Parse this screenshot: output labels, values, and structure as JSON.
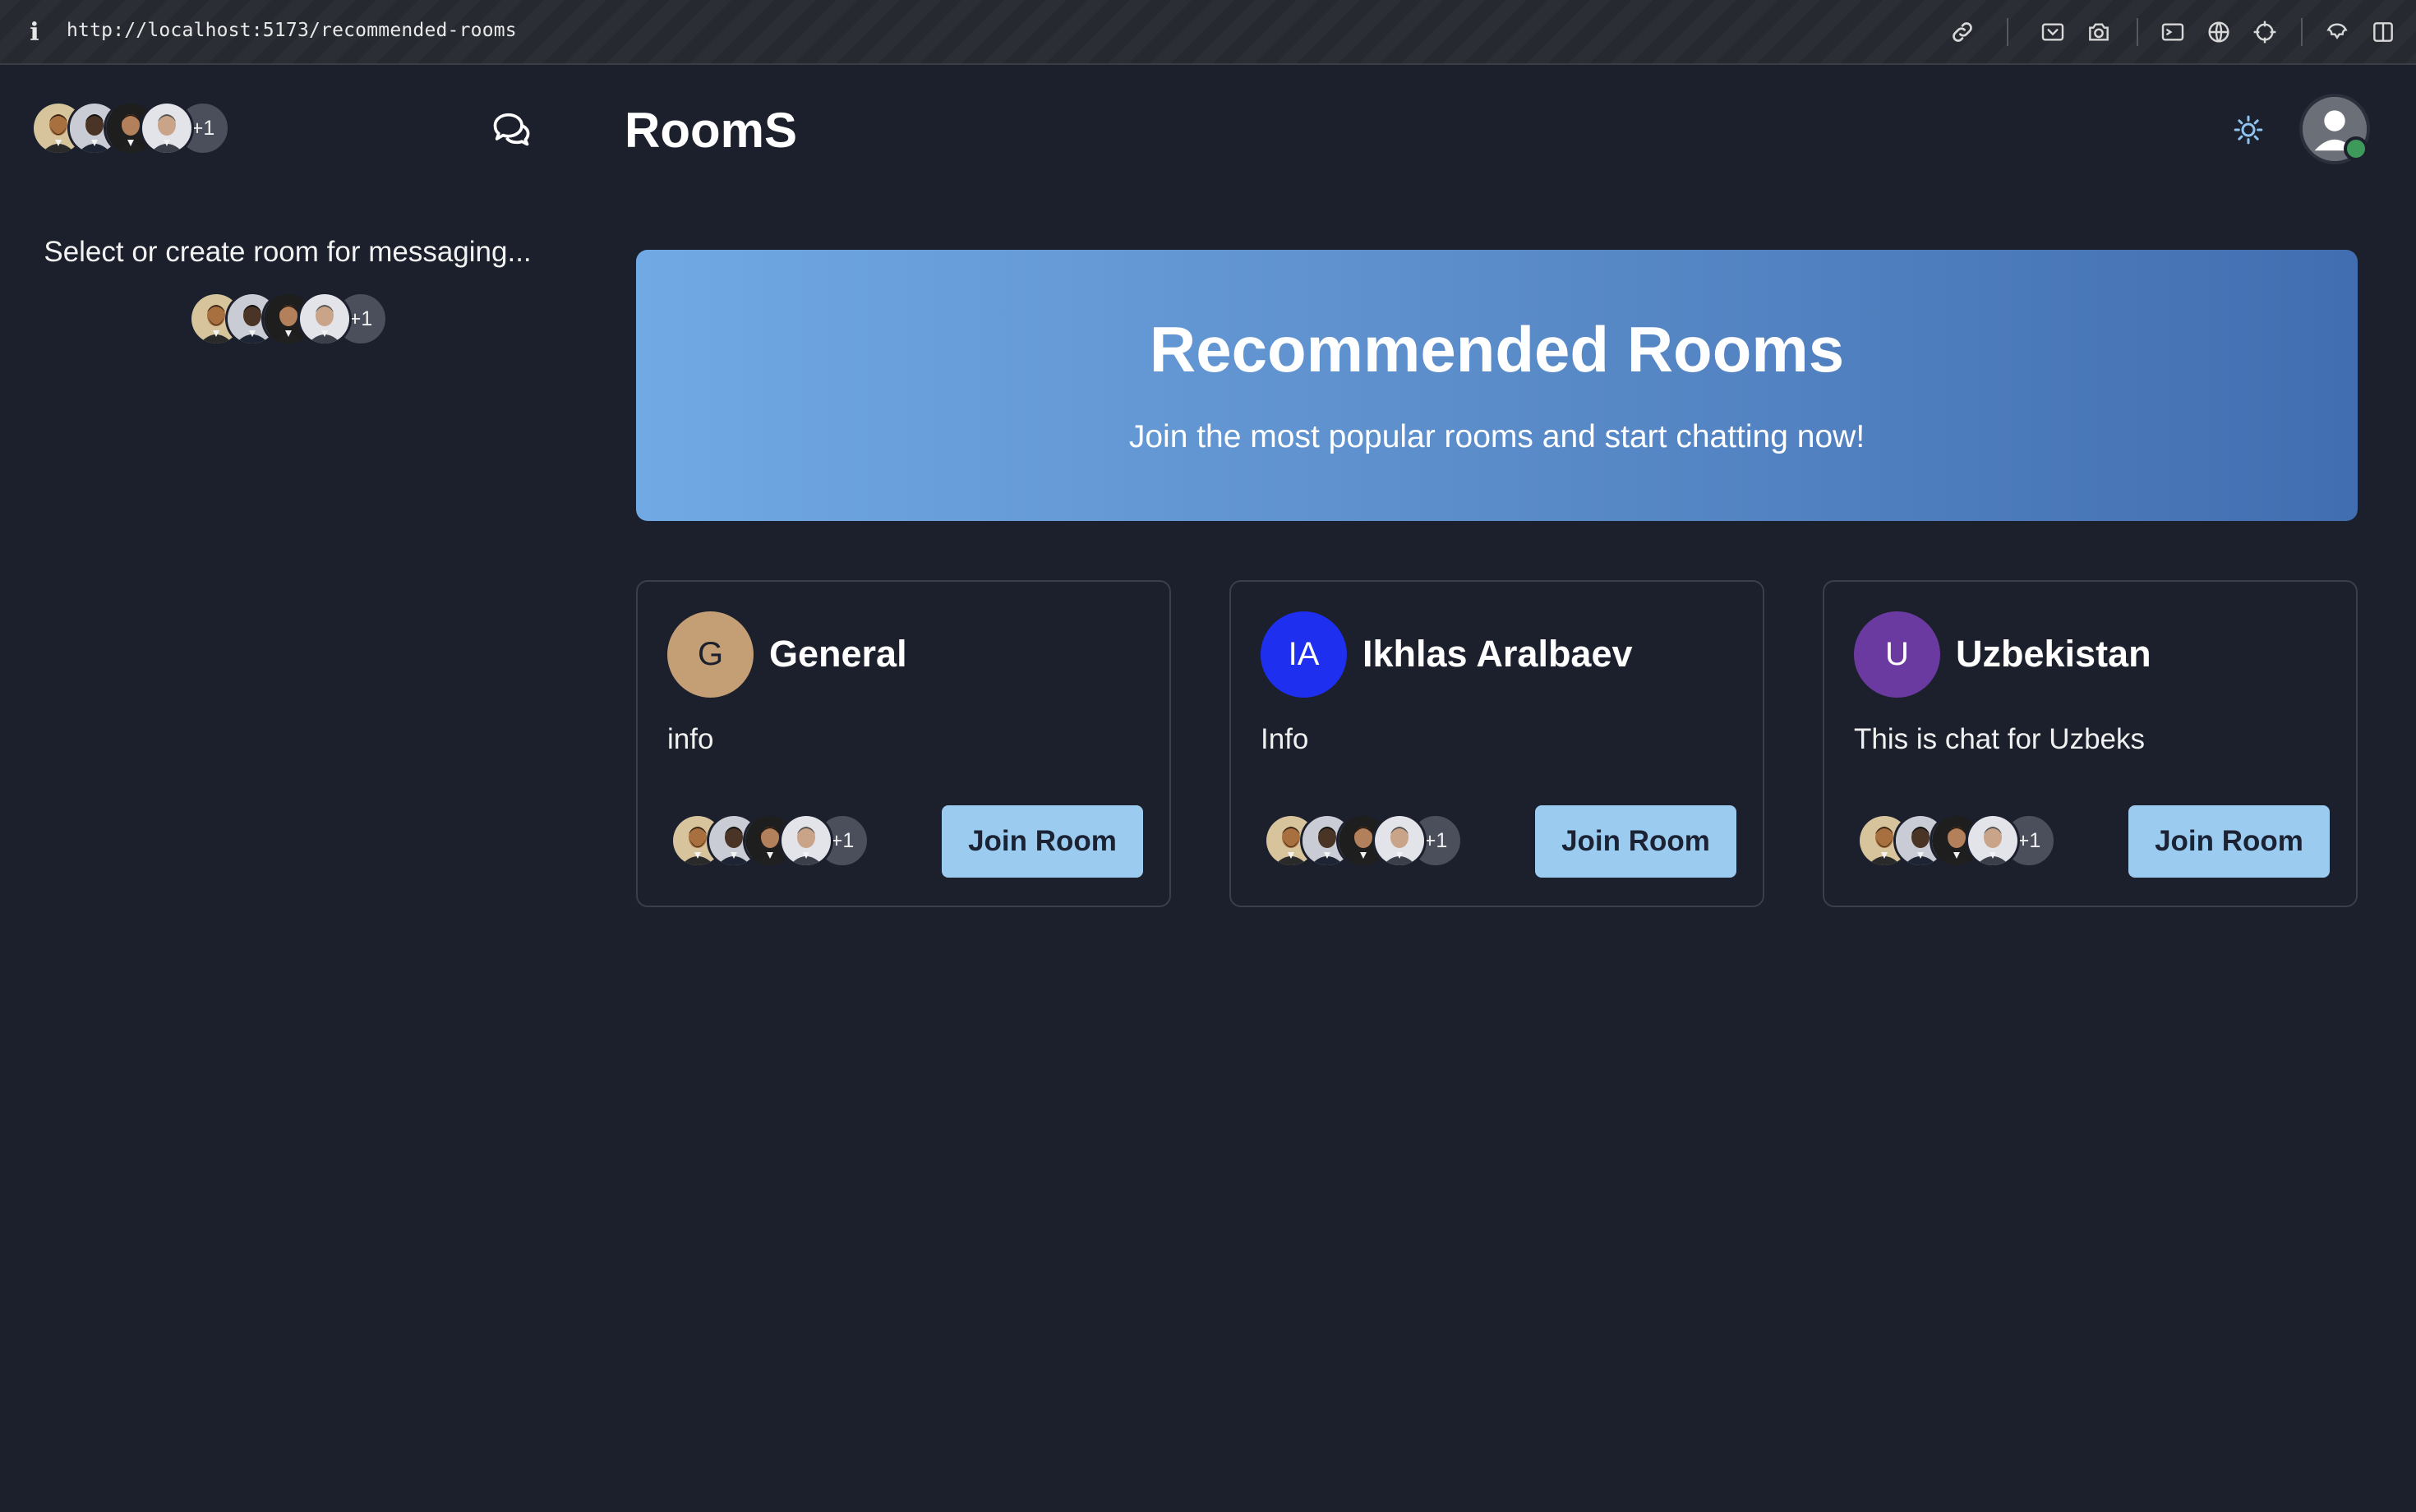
{
  "browser": {
    "url": "http://localhost:5173/recommended-rooms",
    "icons": [
      "link-icon",
      "screenshot-area-icon",
      "camera-icon",
      "terminal-icon",
      "globe-icon",
      "crosshair-icon",
      "extensions-icon",
      "sidebar-toggle-icon"
    ]
  },
  "sidebar": {
    "more_count": "+1",
    "empty_message": "Select or create room for messaging..."
  },
  "header": {
    "title": "RoomS",
    "theme_icon": "sun-icon",
    "user_status": "online"
  },
  "hero": {
    "title": "Recommended Rooms",
    "subtitle": "Join the most popular rooms and start chatting now!"
  },
  "rooms": [
    {
      "initials": "G",
      "name": "General",
      "description": "info",
      "avatar_color": "#c49e74",
      "more_count": "+1",
      "join_label": "Join Room"
    },
    {
      "initials": "IA",
      "name": "Ikhlas Aralbaev",
      "description": "Info",
      "avatar_color": "#1e2ff0",
      "more_count": "+1",
      "join_label": "Join Room"
    },
    {
      "initials": "U",
      "name": "Uzbekistan",
      "description": "This is chat for Uzbeks",
      "avatar_color": "#6b3aa0",
      "more_count": "+1",
      "join_label": "Join Room"
    }
  ],
  "colors": {
    "background": "#1c202c",
    "hero_gradient_start": "#70a9e4",
    "hero_gradient_end": "#416eb0",
    "join_button": "#9ccbf0",
    "online": "#3e9a5a"
  }
}
